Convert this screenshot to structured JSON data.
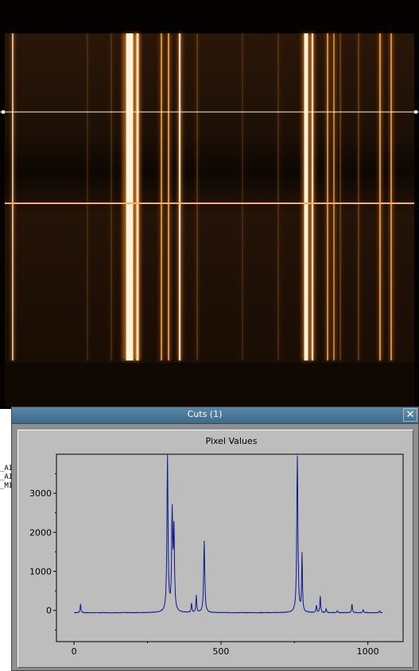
{
  "background_window": {
    "visible_text": [
      "_AI",
      "_AI",
      "_MI"
    ]
  },
  "cuts_window": {
    "title": "Cuts (1)",
    "close_glyph": "✕",
    "close_icon": "close-icon"
  },
  "colors": {
    "titlebar": "#4a7899",
    "plot_background": "#bdbdbd",
    "plot_line": "#0b1a8f",
    "image_glow": "#ff9a2e"
  },
  "chart_data": {
    "type": "line",
    "title": "Pixel Values",
    "xlabel": "",
    "ylabel": "",
    "xlim": [
      -60,
      1120
    ],
    "ylim": [
      -800,
      4000
    ],
    "x_ticks": [
      0,
      500,
      1000
    ],
    "y_ticks": [
      0,
      1000,
      2000,
      3000
    ],
    "x_tick_labels": [
      "0",
      "500",
      "1000"
    ],
    "y_tick_labels": [
      "0",
      "1000",
      "2000",
      "3000"
    ],
    "grid": false,
    "baseline": -60,
    "peaks": [
      {
        "x": 22,
        "y": 160
      },
      {
        "x": 318,
        "y": 3950
      },
      {
        "x": 334,
        "y": 2400
      },
      {
        "x": 340,
        "y": 1950
      },
      {
        "x": 400,
        "y": 180
      },
      {
        "x": 416,
        "y": 380
      },
      {
        "x": 443,
        "y": 1780
      },
      {
        "x": 760,
        "y": 3950
      },
      {
        "x": 776,
        "y": 1420
      },
      {
        "x": 825,
        "y": 120
      },
      {
        "x": 838,
        "y": 360
      },
      {
        "x": 858,
        "y": 40
      },
      {
        "x": 896,
        "y": -10
      },
      {
        "x": 946,
        "y": 160
      },
      {
        "x": 984,
        "y": 20
      },
      {
        "x": 1040,
        "y": -20
      }
    ]
  }
}
